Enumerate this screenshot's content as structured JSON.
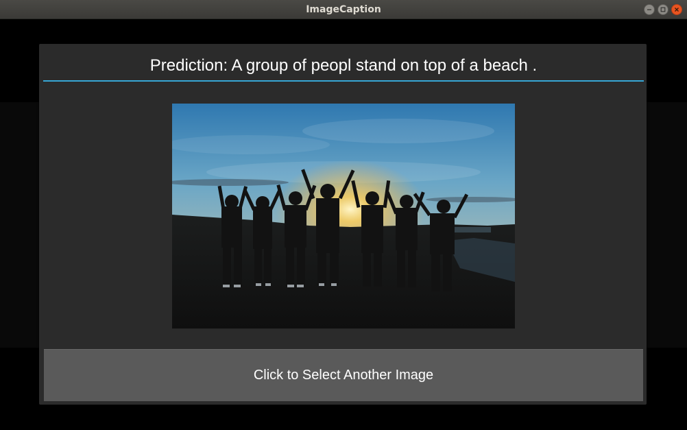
{
  "window": {
    "title": "ImageCaption"
  },
  "titlebar_buttons": {
    "minimize_icon": "minimize-icon",
    "maximize_icon": "maximize-icon",
    "close_icon": "close-icon"
  },
  "popup": {
    "title": "Prediction: A group of peopl stand on top of a beach .",
    "image_alt": "group of people silhouetted at sunset with raised arms",
    "select_button_label": "Click to Select Another Image"
  },
  "colors": {
    "accent": "#37a7d6",
    "close_button": "#e95420",
    "popup_bg": "#2b2b2b",
    "button_bg": "#5a5a5a"
  }
}
